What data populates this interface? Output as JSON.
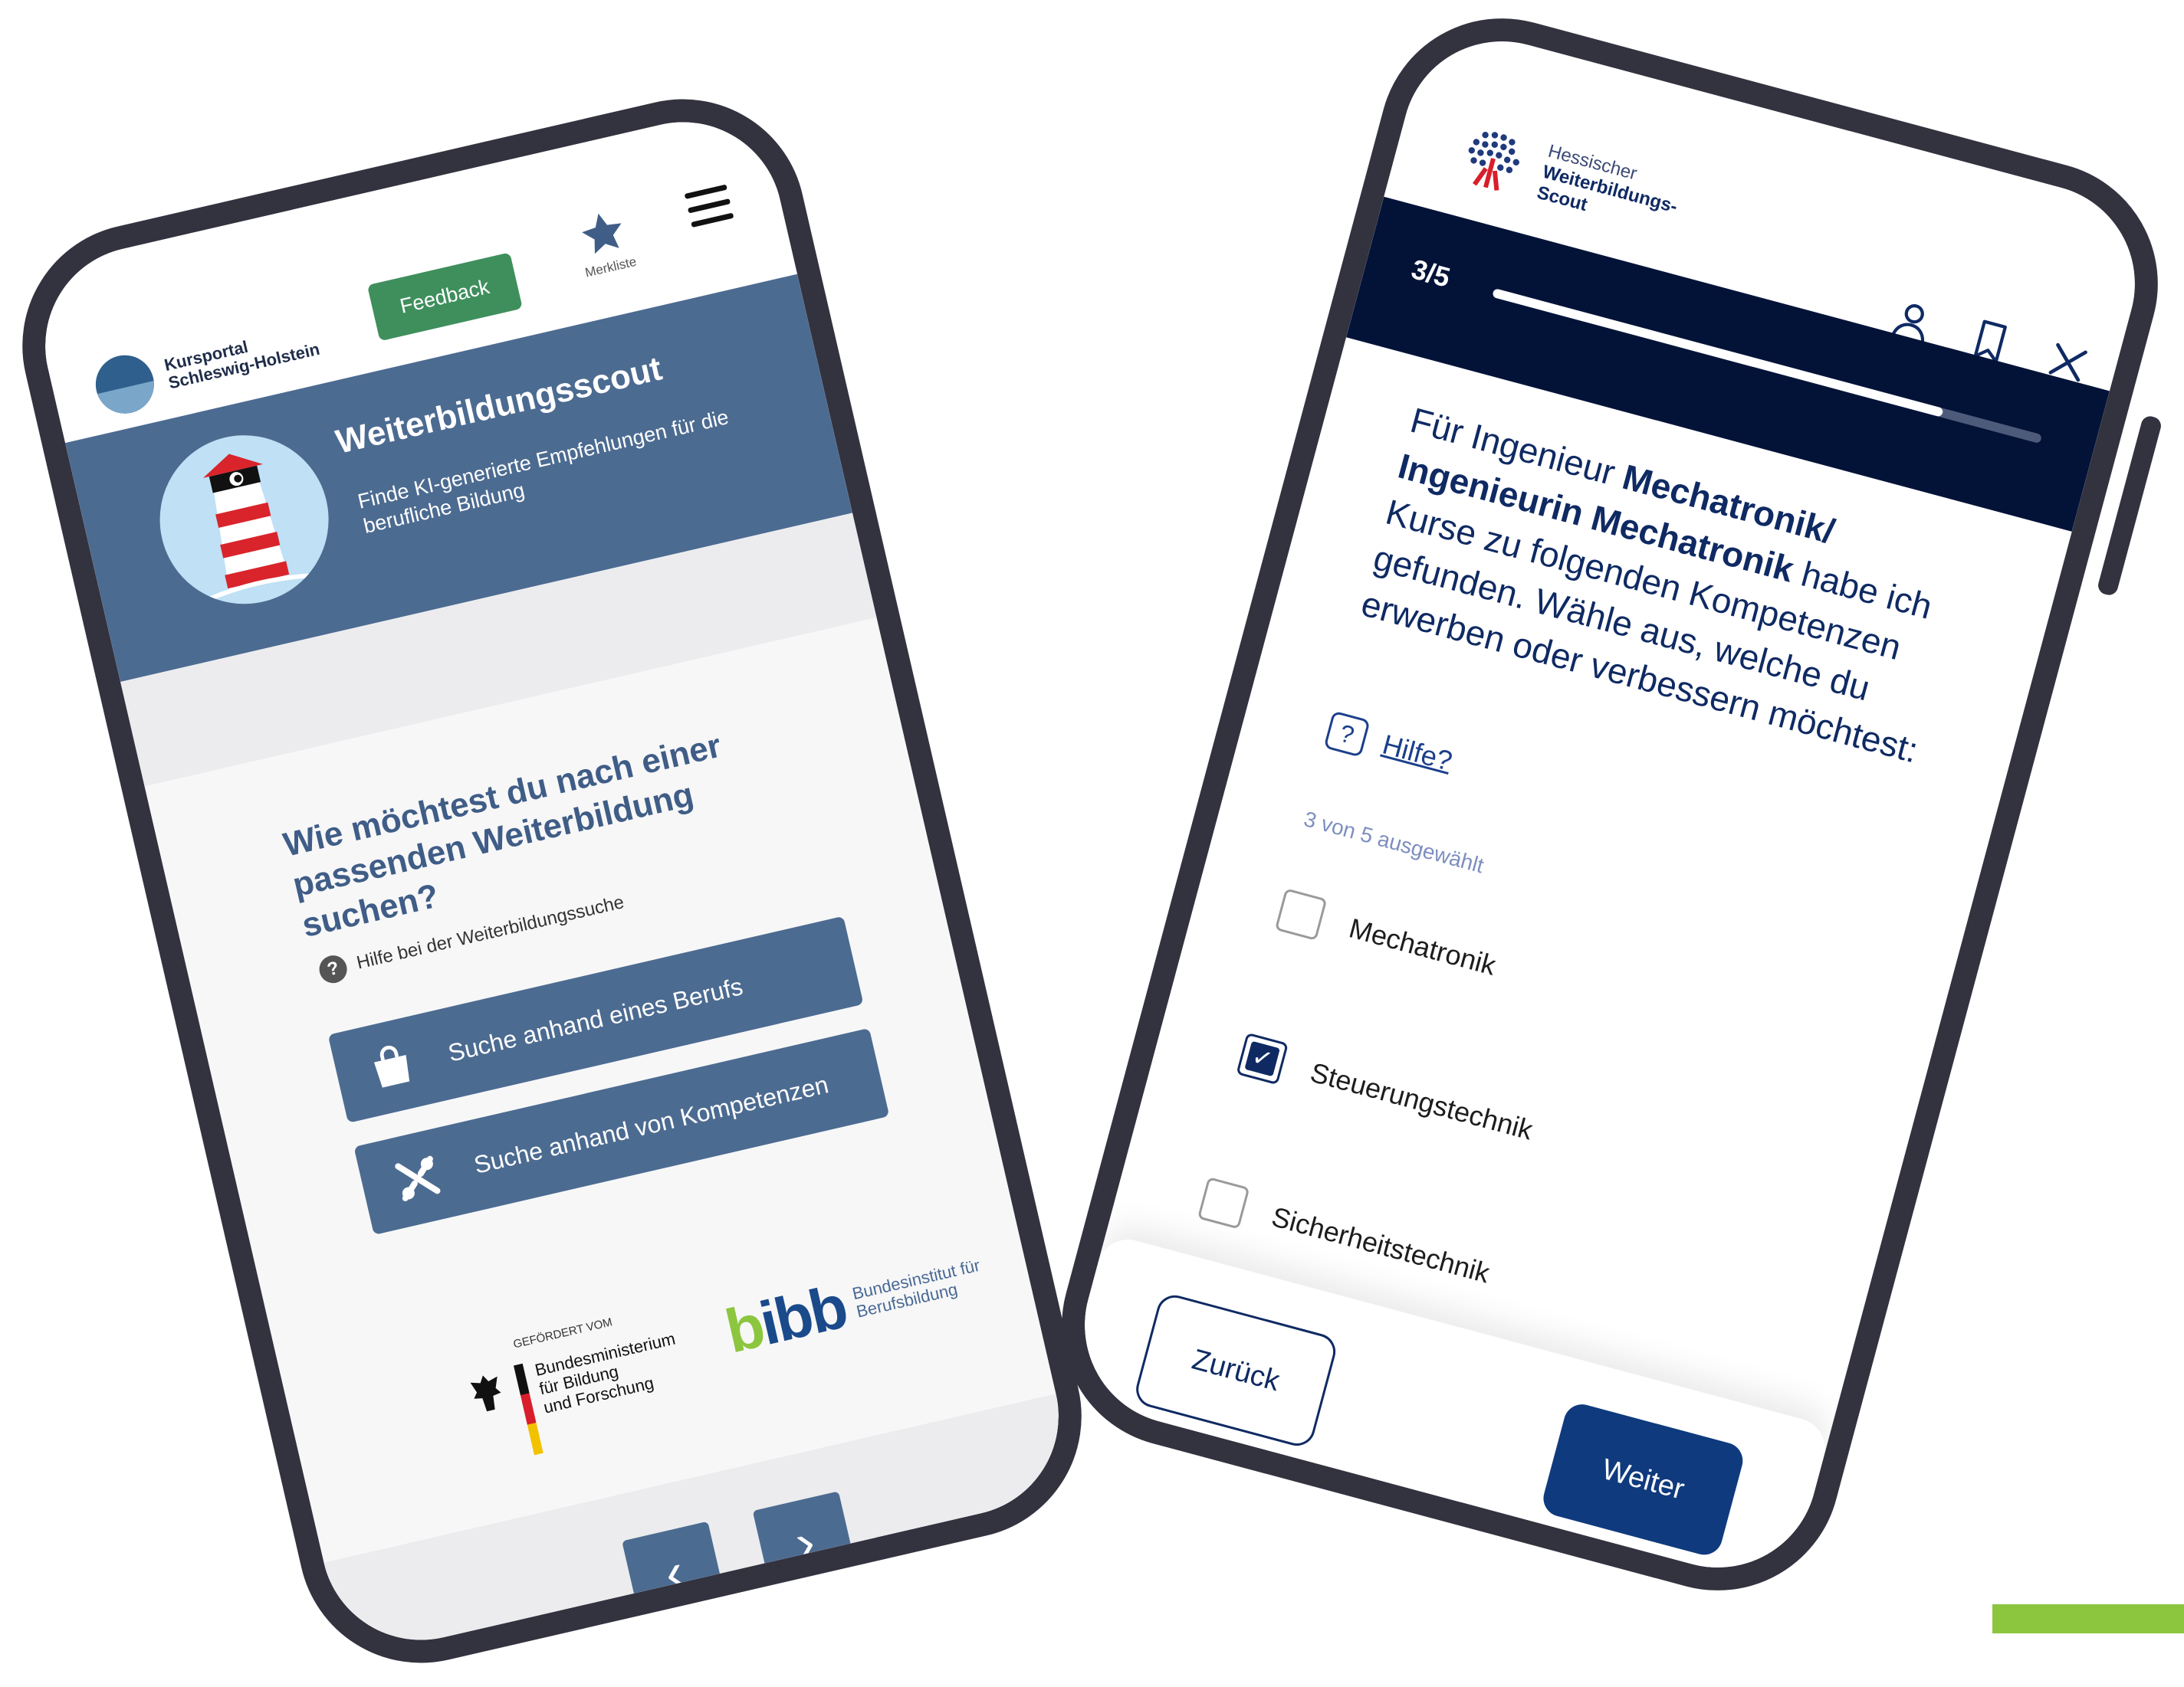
{
  "phone1": {
    "logo_text_line1": "Kursportal",
    "logo_text_line2": "Schleswig-Holstein",
    "feedback_label": "Feedback",
    "favorites_label": "Merkliste",
    "menu_icon": "hamburger-menu-icon",
    "hero": {
      "title": "Weiterbildungsscout",
      "subtitle": "Finde KI-generierte Empfehlungen für die berufliche Bildung"
    },
    "question": "Wie möchtest du nach einer passenden Weiterbildung suchen?",
    "help_label": "Hilfe bei der Weiterbildungssuche",
    "actions": [
      {
        "label": "Suche anhand eines Berufs",
        "icon": "shopping-bag-icon"
      },
      {
        "label": "Suche anhand von Kompetenzen",
        "icon": "tools-icon"
      }
    ],
    "sponsors": {
      "bmbf_small": "GEFÖRDERT VOM",
      "bmbf_line1": "Bundesministerium",
      "bmbf_line2": "für Bildung",
      "bmbf_line3": "und Forschung",
      "bibb_logo": "bibb",
      "bibb_line1": "Bundesinstitut für",
      "bibb_line2": "Berufsbildung"
    },
    "nav": {
      "prev_icon": "chevron-left-icon",
      "next_icon": "chevron-right-icon"
    }
  },
  "phone2": {
    "logo_line1": "Hessischer",
    "logo_line2": "Weiterbildungs-",
    "logo_line3": "Scout",
    "progress_label": "3/5",
    "progress_fraction": 0.82,
    "question_part1": "Für Ingenieur ",
    "question_bold": "Mechatronik/ Ingenieurin Mechatronik",
    "question_part2": " habe ich Kurse zu folgenden Kompetenzen gefunden. Wähle aus, welche du erwerben oder verbessern möchtest:",
    "help_label": "Hilfe?",
    "count_label": "3 von 5 ausgewählt",
    "options": [
      {
        "label": "Mechatronik",
        "checked": false
      },
      {
        "label": "Steuerungstechnik",
        "checked": true
      },
      {
        "label": "Sicherheitstechnik",
        "checked": false
      }
    ],
    "back_label": "Zurück",
    "next_label": "Weiter",
    "colors": {
      "navy": "#031338",
      "primary": "#0f3a7d",
      "accent_green": "#8cc63f"
    }
  }
}
